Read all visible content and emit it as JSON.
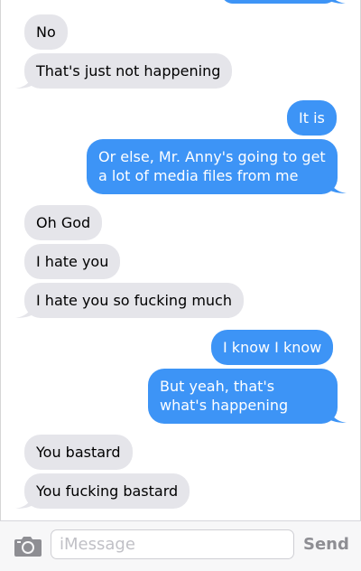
{
  "messages": [
    {
      "direction": "incoming",
      "text": "No"
    },
    {
      "direction": "incoming",
      "text": "That's just not happening"
    },
    {
      "direction": "outgoing",
      "text": "It is"
    },
    {
      "direction": "outgoing",
      "text": "Or else, Mr. Anny's going to get a lot of media files from me"
    },
    {
      "direction": "incoming",
      "text": "Oh God"
    },
    {
      "direction": "incoming",
      "text": "I hate you"
    },
    {
      "direction": "incoming",
      "text": "I hate you so fucking much"
    },
    {
      "direction": "outgoing",
      "text": "I know I know"
    },
    {
      "direction": "outgoing",
      "text": "But yeah, that's what's happening"
    },
    {
      "direction": "incoming",
      "text": "You bastard"
    },
    {
      "direction": "incoming",
      "text": "You fucking bastard"
    }
  ],
  "composer": {
    "placeholder": "iMessage",
    "send_label": "Send",
    "camera_icon": "camera-icon"
  },
  "colors": {
    "incoming_bubble": "#e5e5ea",
    "outgoing_bubble": "#3d94f6",
    "outgoing_text": "#ffffff",
    "send_disabled": "#8e8e93"
  }
}
